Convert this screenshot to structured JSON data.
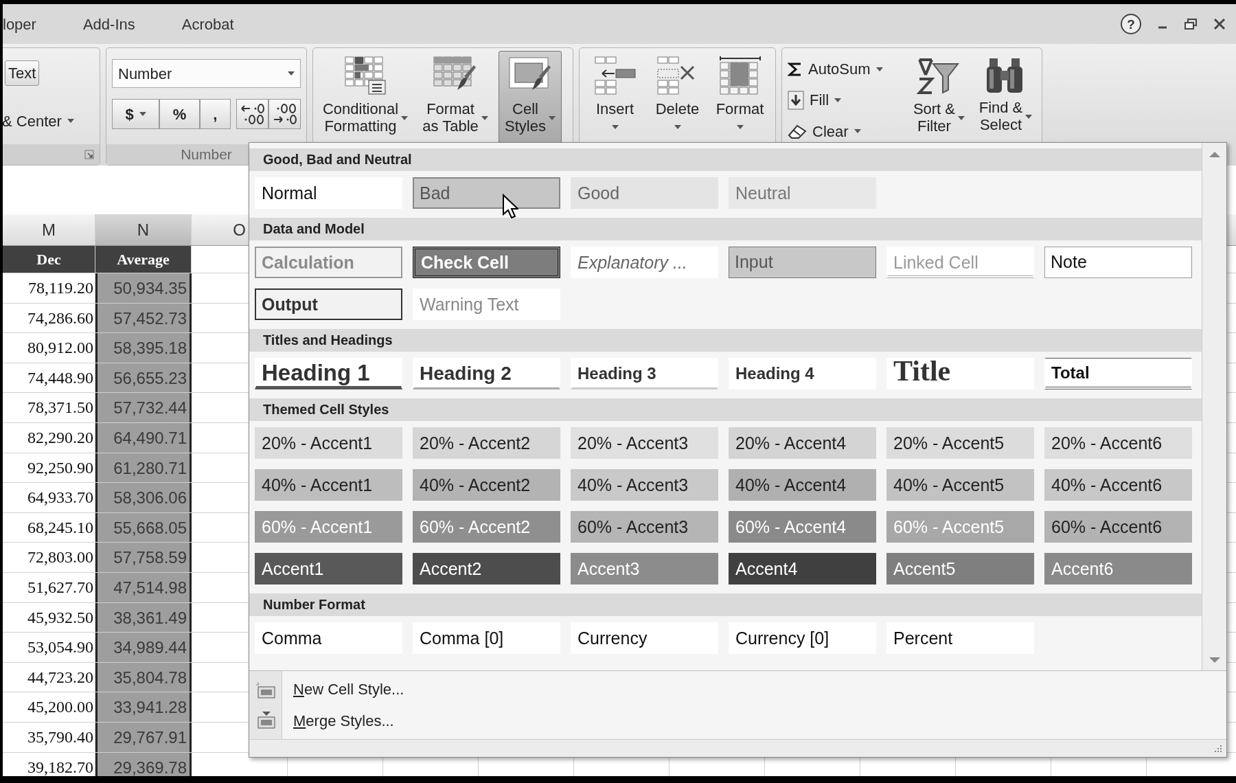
{
  "title_bar": {
    "tabs": [
      {
        "label": "loper"
      },
      {
        "label": "Add-Ins"
      },
      {
        "label": "Acrobat"
      }
    ],
    "help": "?"
  },
  "ribbon": {
    "alignment": {
      "wrap_text": "Text",
      "merge": "& Center"
    },
    "number": {
      "format": "Number",
      "buttons": [
        {
          "label": "$",
          "dropdown": true
        },
        {
          "label": "%",
          "dropdown": false
        },
        {
          "label": ",",
          "dropdown": false
        }
      ],
      "group_label": "Number"
    },
    "styles": [
      {
        "label": "Conditional\nFormatting",
        "kind": "conditional",
        "dropdown": true,
        "selected": false
      },
      {
        "label": "Format\nas Table",
        "kind": "table",
        "dropdown": true,
        "selected": false
      },
      {
        "label": "Cell\nStyles",
        "kind": "cellstyles",
        "dropdown": true,
        "selected": true
      }
    ],
    "cells": [
      {
        "label": "Insert",
        "kind": "insert",
        "dropdown": true
      },
      {
        "label": "Delete",
        "kind": "delete",
        "dropdown": true
      },
      {
        "label": "Format",
        "kind": "format",
        "dropdown": true
      }
    ],
    "editing_small": [
      {
        "label": "AutoSum",
        "kind": "sum",
        "dropdown": true
      },
      {
        "label": "Fill",
        "kind": "fill",
        "dropdown": true
      },
      {
        "label": "Clear",
        "kind": "clear",
        "dropdown": true
      }
    ],
    "editing_large": [
      {
        "label": "Sort &\nFilter",
        "kind": "sort",
        "dropdown": true
      },
      {
        "label": "Find &\nSelect",
        "kind": "find",
        "dropdown": true
      }
    ]
  },
  "sheet": {
    "columns": [
      {
        "label": "M",
        "selected": false
      },
      {
        "label": "N",
        "selected": true
      },
      {
        "label": "O",
        "selected": false
      }
    ],
    "header": [
      "Dec",
      "Average"
    ],
    "rows": [
      [
        "78,119.20",
        "50,934.35"
      ],
      [
        "74,286.60",
        "57,452.73"
      ],
      [
        "80,912.00",
        "58,395.18"
      ],
      [
        "74,448.90",
        "56,655.23"
      ],
      [
        "78,371.50",
        "57,732.44"
      ],
      [
        "82,290.20",
        "64,490.71"
      ],
      [
        "92,250.90",
        "61,280.71"
      ],
      [
        "64,933.70",
        "58,306.06"
      ],
      [
        "68,245.10",
        "55,668.05"
      ],
      [
        "72,803.00",
        "57,758.59"
      ],
      [
        "51,627.70",
        "47,514.98"
      ],
      [
        "45,932.50",
        "38,361.49"
      ],
      [
        "53,054.90",
        "34,989.44"
      ],
      [
        "44,723.20",
        "35,804.78"
      ],
      [
        "45,200.00",
        "33,941.28"
      ],
      [
        "35,790.40",
        "29,767.91"
      ],
      [
        "39,182.70",
        "29,369.78"
      ]
    ]
  },
  "gallery": {
    "sections": [
      {
        "title": "Good, Bad and Neutral",
        "rows": [
          [
            {
              "label": "Normal",
              "kind": "normal",
              "hovered": false
            },
            {
              "label": "Bad",
              "kind": "bad",
              "hovered": true
            },
            {
              "label": "Good",
              "kind": "good",
              "hovered": false
            },
            {
              "label": "Neutral",
              "kind": "neutral",
              "hovered": false
            }
          ]
        ]
      },
      {
        "title": "Data and Model",
        "rows": [
          [
            {
              "label": "Calculation",
              "kind": "calculation",
              "hovered": false
            },
            {
              "label": "Check Cell",
              "kind": "check",
              "hovered": false
            },
            {
              "label": "Explanatory ...",
              "kind": "explanatory",
              "hovered": false
            },
            {
              "label": "Input",
              "kind": "input",
              "hovered": false
            },
            {
              "label": "Linked Cell",
              "kind": "linked",
              "hovered": false
            },
            {
              "label": "Note",
              "kind": "note",
              "hovered": false
            }
          ],
          [
            {
              "label": "Output",
              "kind": "output",
              "hovered": false
            },
            {
              "label": "Warning Text",
              "kind": "warning",
              "hovered": false
            }
          ]
        ]
      },
      {
        "title": "Titles and Headings",
        "rows": [
          [
            {
              "label": "Heading 1",
              "kind": "heading1",
              "hovered": false
            },
            {
              "label": "Heading 2",
              "kind": "heading2",
              "hovered": false
            },
            {
              "label": "Heading 3",
              "kind": "heading3",
              "hovered": false
            },
            {
              "label": "Heading 4",
              "kind": "heading4",
              "hovered": false
            },
            {
              "label": "Title",
              "kind": "title",
              "hovered": false
            },
            {
              "label": "Total",
              "kind": "total",
              "hovered": false
            }
          ]
        ]
      },
      {
        "title": "Themed Cell Styles",
        "rows": [
          [
            {
              "label": "20% - Accent1",
              "kind": "themed",
              "color": "#dcdcdc",
              "hovered": false
            },
            {
              "label": "20% - Accent2",
              "kind": "themed",
              "color": "#d6d6d6",
              "hovered": false
            },
            {
              "label": "20% - Accent3",
              "kind": "themed",
              "color": "#e0e0e0",
              "hovered": false
            },
            {
              "label": "20% - Accent4",
              "kind": "themed",
              "color": "#d4d4d4",
              "hovered": false
            },
            {
              "label": "20% - Accent5",
              "kind": "themed",
              "color": "#dcdcdc",
              "hovered": false
            },
            {
              "label": "20% - Accent6",
              "kind": "themed",
              "color": "#dedede",
              "hovered": false
            }
          ],
          [
            {
              "label": "40% - Accent1",
              "kind": "themed",
              "color": "#bdbdbd",
              "hovered": false
            },
            {
              "label": "40% - Accent2",
              "kind": "themed",
              "color": "#b3b3b3",
              "hovered": false
            },
            {
              "label": "40% - Accent3",
              "kind": "themed",
              "color": "#c9c9c9",
              "hovered": false
            },
            {
              "label": "40% - Accent4",
              "kind": "themed",
              "color": "#b0b0b0",
              "hovered": false
            },
            {
              "label": "40% - Accent5",
              "kind": "themed",
              "color": "#c2c2c2",
              "hovered": false
            },
            {
              "label": "40% - Accent6",
              "kind": "themed",
              "color": "#c8c8c8",
              "hovered": false
            }
          ],
          [
            {
              "label": "60% - Accent1",
              "kind": "themed",
              "color": "#9a9a9a",
              "hovered": false
            },
            {
              "label": "60% - Accent2",
              "kind": "themed",
              "color": "#8f8f8f",
              "hovered": false
            },
            {
              "label": "60% - Accent3",
              "kind": "themed",
              "color": "#b5b5b5",
              "hovered": false
            },
            {
              "label": "60% - Accent4",
              "kind": "themed",
              "color": "#8a8a8a",
              "hovered": false
            },
            {
              "label": "60% - Accent5",
              "kind": "themed",
              "color": "#a8a8a8",
              "hovered": false
            },
            {
              "label": "60% - Accent6",
              "kind": "themed",
              "color": "#b3b3b3",
              "hovered": false
            }
          ],
          [
            {
              "label": "Accent1",
              "kind": "themed",
              "color": "#595959",
              "hovered": false
            },
            {
              "label": "Accent2",
              "kind": "themed",
              "color": "#4d4d4d",
              "hovered": false
            },
            {
              "label": "Accent3",
              "kind": "themed",
              "color": "#8c8c8c",
              "hovered": false
            },
            {
              "label": "Accent4",
              "kind": "themed",
              "color": "#404040",
              "hovered": false
            },
            {
              "label": "Accent5",
              "kind": "themed",
              "color": "#7f7f7f",
              "hovered": false
            },
            {
              "label": "Accent6",
              "kind": "themed",
              "color": "#8a8a8a",
              "hovered": false
            }
          ]
        ]
      },
      {
        "title": "Number Format",
        "rows": [
          [
            {
              "label": "Comma",
              "kind": "plain",
              "hovered": false
            },
            {
              "label": "Comma [0]",
              "kind": "plain",
              "hovered": false
            },
            {
              "label": "Currency",
              "kind": "plain",
              "hovered": false
            },
            {
              "label": "Currency [0]",
              "kind": "plain",
              "hovered": false
            },
            {
              "label": "Percent",
              "kind": "plain",
              "hovered": false
            }
          ]
        ]
      }
    ],
    "commands": [
      {
        "label": "New Cell Style...",
        "kind": "new"
      },
      {
        "label": "Merge Styles...",
        "kind": "merge"
      }
    ]
  }
}
